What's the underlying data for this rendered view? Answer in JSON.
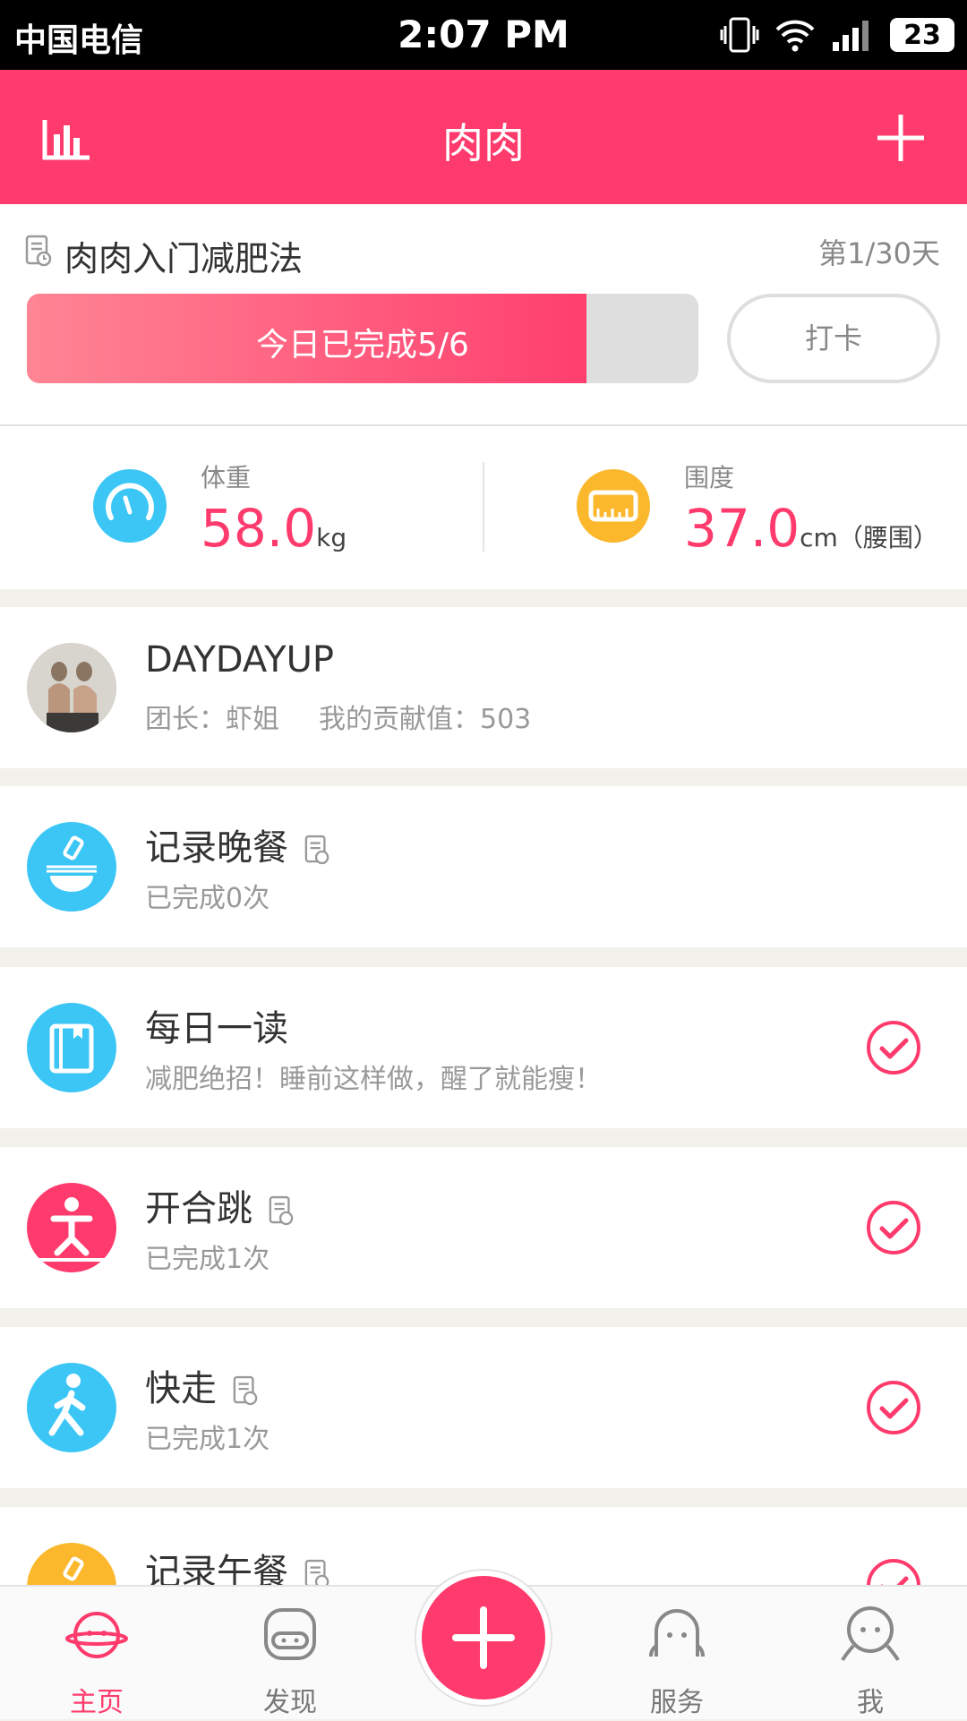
{
  "status_bar": {
    "carrier": "中国电信",
    "time": "2:07 PM",
    "battery": "23"
  },
  "header": {
    "title": "肉肉"
  },
  "plan": {
    "name": "肉肉入门减肥法",
    "day": "第1/30天",
    "progress_label": "今日已完成5/6",
    "progress_fraction": 0.833,
    "checkin_label": "打卡"
  },
  "metrics": {
    "weight": {
      "caption": "体重",
      "value": "58.0",
      "unit": "kg"
    },
    "girth": {
      "caption": "围度",
      "value": "37.0",
      "unit": "cm",
      "note": "（腰围）"
    }
  },
  "group": {
    "name": "DAYDAYUP",
    "leader": "团长：虾姐",
    "contribution": "我的贡献值：503"
  },
  "tasks": [
    {
      "title": "记录晚餐",
      "subtitle": "已完成0次",
      "icon": "bowl-icon",
      "color": "#3cc6f5",
      "done": false
    },
    {
      "title": "每日一读",
      "subtitle": "减肥绝招！睡前这样做，醒了就能瘦！",
      "icon": "book-icon",
      "color": "#3cc6f5",
      "done": true
    },
    {
      "title": "开合跳",
      "subtitle": "已完成1次",
      "icon": "jumping-jack-icon",
      "color": "#ff3a6c",
      "done": true
    },
    {
      "title": "快走",
      "subtitle": "已完成1次",
      "icon": "walking-icon",
      "color": "#3cc6f5",
      "done": true
    },
    {
      "title": "记录午餐",
      "subtitle": "",
      "icon": "lunch-icon",
      "color": "#fbb82d",
      "done": true
    }
  ],
  "tabs": [
    {
      "label": "主页",
      "icon": "home-face-icon",
      "active": true
    },
    {
      "label": "发现",
      "icon": "discover-face-icon",
      "active": false
    },
    {
      "label": "服务",
      "icon": "service-face-icon",
      "active": false
    },
    {
      "label": "我",
      "icon": "me-face-icon",
      "active": false
    }
  ],
  "colors": {
    "accent": "#ff3a6c",
    "blue": "#3cc6f5",
    "orange": "#fbb82d"
  }
}
